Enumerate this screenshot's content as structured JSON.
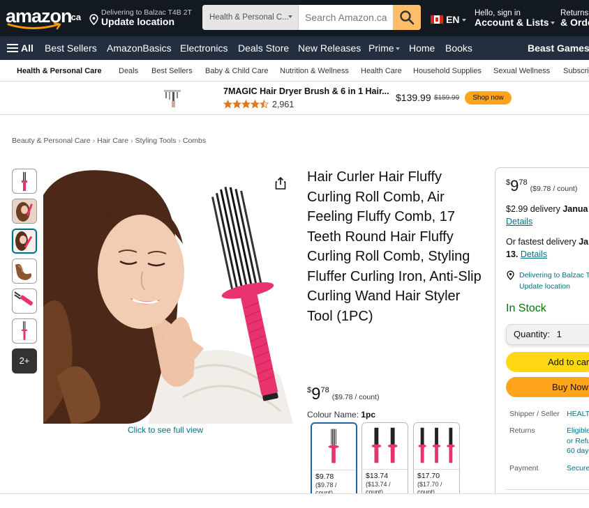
{
  "header": {
    "logo_text": "amazon",
    "logo_suffix": ".ca",
    "deliver_line1": "Delivering to Balzac T4B 2T",
    "deliver_line2": "Update location",
    "search_category": "Health & Personal C...",
    "search_placeholder": "Search Amazon.ca",
    "lang_code": "EN",
    "account_line1": "Hello, sign in",
    "account_line2": "Account & Lists",
    "returns_line1": "Returns",
    "returns_line2": "& Orde"
  },
  "main_nav": {
    "all_label": "All",
    "items": [
      "Best Sellers",
      "AmazonBasics",
      "Electronics",
      "Deals Store",
      "New Releases",
      "Prime",
      "Home",
      "Books"
    ],
    "promo": "Beast Games"
  },
  "sub_nav": {
    "category": "Health & Personal Care",
    "items": [
      "Deals",
      "Best Sellers",
      "Baby & Child Care",
      "Nutrition & Wellness",
      "Health Care",
      "Household Supplies",
      "Sexual Wellness",
      "Subscri"
    ]
  },
  "ad": {
    "title": "7MAGIC Hair Dryer Brush & 6 in 1 Hair...",
    "rating": 4.5,
    "review_count": "2,961",
    "price": "$139.99",
    "old_price": "$159.99",
    "cta": "Shop now"
  },
  "breadcrumb": [
    "Beauty & Personal Care",
    "Hair Care",
    "Styling Tools",
    "Combs"
  ],
  "gallery": {
    "more_label": "2+",
    "full_view": "Click to see full view"
  },
  "product": {
    "title": "Hair Curler Hair Fluffy Curling Roll Comb, Air Feeling Fluffy Comb, 17 Teeth Round Hair Fluffy Curling Roll Comb, Styling Fluffer Curling Iron, Anti-Slip Curling Wand Hair Styler Tool (1PC)",
    "price_symbol": "$",
    "price_whole": "9",
    "price_fraction": "78",
    "price_unit": "($9.78 / count)",
    "colour_label": "Colour Name:",
    "colour_value": "1pc",
    "swatches": [
      {
        "price": "$9.78",
        "unit1": "($9.78 /",
        "unit2": "count)"
      },
      {
        "price": "$13.74",
        "unit1": "($13.74 /",
        "unit2": "count)"
      },
      {
        "price": "$17.70",
        "unit1": "($17.70 /",
        "unit2": "count)"
      }
    ]
  },
  "buybox": {
    "price_symbol": "$",
    "price_whole": "9",
    "price_fraction": "78",
    "price_unit": "($9.78 / count)",
    "delivery_text": "$2.99 delivery",
    "delivery_date": "Janua",
    "details_link": "Details",
    "fastest_text": "Or fastest delivery",
    "fastest_date_cut": "Ja",
    "fastest_day": "13.",
    "deliver_to": "Delivering to Balzac T",
    "update_location": "Update location",
    "stock": "In Stock",
    "quantity_label": "Quantity:",
    "quantity_value": "1",
    "add_to_cart": "Add to car",
    "buy_now": "Buy Now",
    "shipper_label": "Shipper / Seller",
    "shipper_value": "HEALT",
    "returns_label": "Returns",
    "returns_value1": "Eligible",
    "returns_value2": "or Refu",
    "returns_value3": "60 day",
    "payment_label": "Payment",
    "payment_value": "Secure"
  },
  "colors": {
    "nav_dark": "#131921",
    "nav_mid": "#232f3e",
    "search_button": "#febd69",
    "link": "#007185",
    "in_stock": "#007600",
    "cart_button": "#ffd814",
    "buy_button": "#ffa41c",
    "product_pink": "#e8336e"
  }
}
